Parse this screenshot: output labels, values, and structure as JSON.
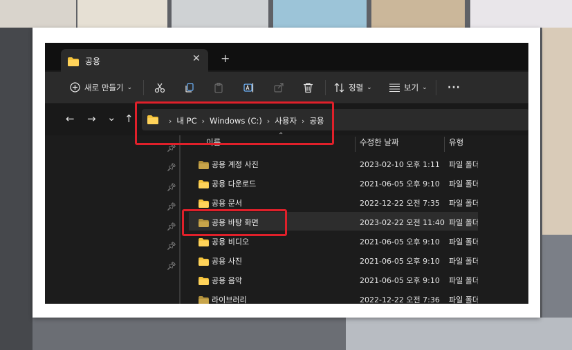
{
  "window": {
    "tab_title": "공용",
    "tab_close_glyph": "✕",
    "new_tab_glyph": "+"
  },
  "toolbar": {
    "new_label": "새로 만들기",
    "sort_label": "정렬",
    "view_label": "보기",
    "more_glyph": "···"
  },
  "nav": {
    "back": "←",
    "forward": "→",
    "recent": "⌄",
    "up": "↑"
  },
  "breadcrumb": [
    "내 PC",
    "Windows (C:)",
    "사용자",
    "공용"
  ],
  "breadcrumb_chevron": "›",
  "columns": {
    "name": "이름",
    "date": "수정한 날짜",
    "type": "유형"
  },
  "files": [
    {
      "name": "공용 계정 사진",
      "date": "2023-02-10 오후 1:11",
      "type": "파일 폴더",
      "icon": "dim-folder"
    },
    {
      "name": "공용 다운로드",
      "date": "2021-06-05 오후 9:10",
      "type": "파일 폴더",
      "icon": "folder"
    },
    {
      "name": "공용 문서",
      "date": "2022-12-22 오전 7:35",
      "type": "파일 폴더",
      "icon": "folder"
    },
    {
      "name": "공용 바탕 화면",
      "date": "2023-02-22 오전 11:40",
      "type": "파일 폴더",
      "icon": "dim-folder"
    },
    {
      "name": "공용 비디오",
      "date": "2021-06-05 오후 9:10",
      "type": "파일 폴더",
      "icon": "folder"
    },
    {
      "name": "공용 사진",
      "date": "2021-06-05 오후 9:10",
      "type": "파일 폴더",
      "icon": "folder"
    },
    {
      "name": "공용 음악",
      "date": "2021-06-05 오후 9:10",
      "type": "파일 폴더",
      "icon": "folder"
    },
    {
      "name": "라이브러리",
      "date": "2022-12-22 오전 7:36",
      "type": "파일 폴더",
      "icon": "dim-folder"
    }
  ],
  "colors": {
    "highlight": "#e0202a",
    "folder": "#f5c33b",
    "window_bg": "#1c1c1c"
  }
}
